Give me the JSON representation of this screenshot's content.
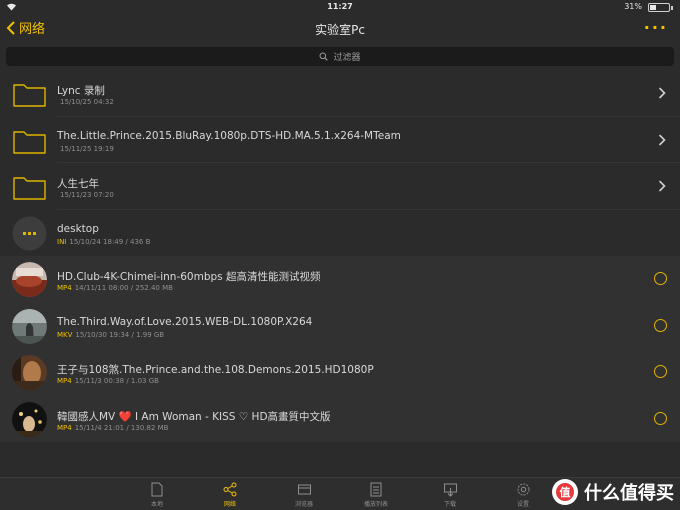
{
  "status": {
    "time": "11:27",
    "battery": "31%",
    "battery_level": 0.31
  },
  "nav": {
    "back_label": "网络",
    "title": "实验室Pc",
    "more_label": "···"
  },
  "filter": {
    "placeholder": "过滤器"
  },
  "items": [
    {
      "title": "Lync 录制",
      "tag": "",
      "meta": "15/10/25 04:32",
      "kind": "folder",
      "accessory": "chevron"
    },
    {
      "title": "The.Little.Prince.2015.BluRay.1080p.DTS-HD.MA.5.1.x264-MTeam",
      "tag": "",
      "meta": "15/11/25 19:19",
      "kind": "folder",
      "accessory": "chevron"
    },
    {
      "title": "人生七年",
      "tag": "",
      "meta": "15/11/23 07:20",
      "kind": "folder",
      "accessory": "chevron"
    },
    {
      "title": "desktop",
      "tag": "INI",
      "meta": "15/10/24 18:49 / 436 B",
      "kind": "file",
      "accessory": "none"
    },
    {
      "title": "HD.Club-4K-Chimei-inn-60mbps 超高清性能测试视频",
      "tag": "MP4",
      "meta": "14/11/11 08:00 / 252.40 MB",
      "kind": "video",
      "accessory": "radio"
    },
    {
      "title": "The.Third.Way.of.Love.2015.WEB-DL.1080P.X264",
      "tag": "MKV",
      "meta": "15/10/30 19:34 / 1.99 GB",
      "kind": "video",
      "accessory": "radio"
    },
    {
      "title": "王子与108煞.The.Prince.and.the.108.Demons.2015.HD1080P",
      "tag": "MP4",
      "meta": "15/11/3 00:38 / 1.03 GB",
      "kind": "video",
      "accessory": "radio"
    },
    {
      "title": "韓國感人MV ❤️ I Am Woman - KISS ♡ HD高畫質中文版",
      "tag": "MP4",
      "meta": "15/11/4 21:01 / 130.82 MB",
      "kind": "video",
      "accessory": "radio"
    }
  ],
  "tabs": [
    {
      "label": "本地",
      "icon": "file-icon"
    },
    {
      "label": "网络",
      "icon": "share-icon",
      "active": true
    },
    {
      "label": "浏览器",
      "icon": "browser-icon"
    },
    {
      "label": "播放列表",
      "icon": "playlist-icon"
    },
    {
      "label": "下载",
      "icon": "download-icon"
    },
    {
      "label": "设置",
      "icon": "gear-icon"
    }
  ],
  "watermark": {
    "text": "什么值得买",
    "logo": "值"
  },
  "colors": {
    "accent": "#f2c200",
    "background": "#2b2b2b"
  }
}
